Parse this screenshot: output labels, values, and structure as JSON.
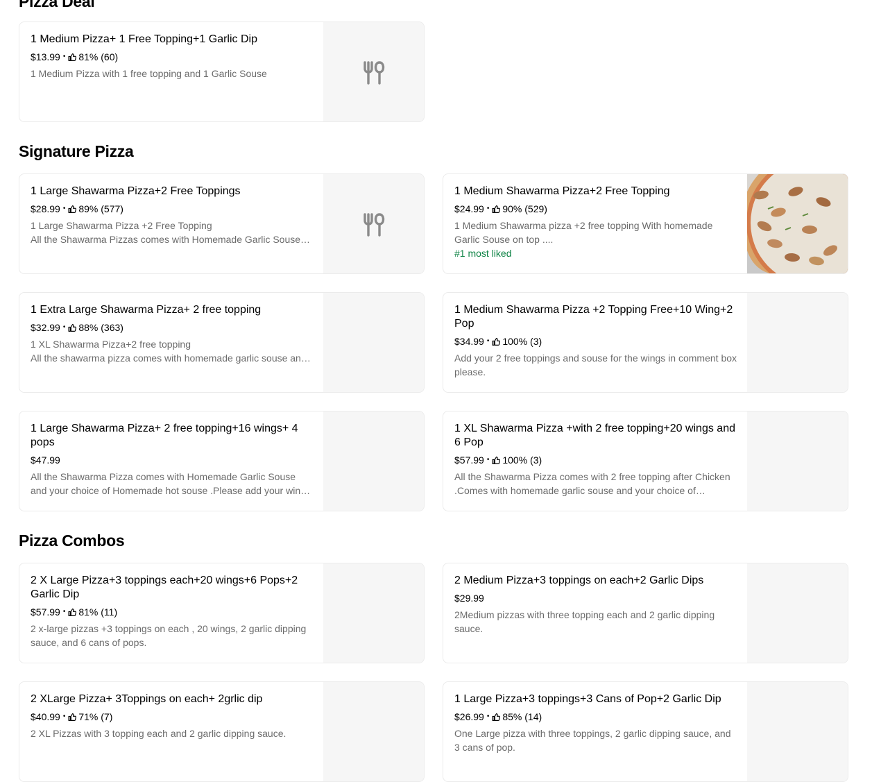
{
  "sections": [
    {
      "title": "Pizza Deal",
      "items": [
        {
          "name": "1 Medium Pizza+ 1 Free Topping+1 Garlic Dip",
          "price": "$13.99",
          "rating": "81% (60)",
          "desc": "1 Medium Pizza with 1 free topping and 1 Garlic Souse",
          "image": "utensils-icon"
        }
      ]
    },
    {
      "title": "Signature Pizza",
      "items": [
        {
          "name": "1 Large Shawarma Pizza+2 Free Toppings",
          "price": "$28.99",
          "rating": "89% (577)",
          "desc": "1 Large Shawarma Pizza +2 Free Topping\nAll the Shawarma Pizzas comes with Homemade Garlic Souse and your choice of Homemade hot souse",
          "image": "utensils-icon"
        },
        {
          "name": "1 Medium Shawarma Pizza+2 Free Topping",
          "price": "$24.99",
          "rating": "90% (529)",
          "desc": "1 Medium Shawarma pizza +2 free topping With homemade Garlic Souse on top ....",
          "tag": "#1 most liked",
          "image": "photo"
        },
        {
          "name": "1 Extra Large Shawarma Pizza+ 2 free topping",
          "price": "$32.99",
          "rating": "88% (363)",
          "desc": "1 XL Shawarma Pizza+2 free topping\nAll the shawarma pizza comes with homemade garlic souse and your choice of homemade hot souse",
          "image": "blank"
        },
        {
          "name": "1 Medium Shawarma Pizza +2 Topping Free+10 Wing+2 Pop",
          "price": "$34.99",
          "rating": "100% (3)",
          "desc": "Add your 2 free toppings and souse for the wings in comment box please.",
          "image": "blank"
        },
        {
          "name": "1 Large Shawarma Pizza+ 2 free topping+16 wings+ 4 pops",
          "price": "$47.99",
          "rating": "",
          "desc": "All the Shawarma Pizza comes with Homemade Garlic Souse and your choice of Homemade hot souse .Please add your wings souse in comment box",
          "image": "blank"
        },
        {
          "name": "1 XL Shawarma Pizza +with 2 free topping+20 wings and 6 Pop",
          "price": "$57.99",
          "rating": "100% (3)",
          "desc": "All the Shawarma Pizza comes with 2 free topping after Chicken .Comes with homemade garlic souse and your choice of homemade hot souse",
          "image": "blank"
        }
      ]
    },
    {
      "title": "Pizza Combos",
      "items": [
        {
          "name": "2 X Large Pizza+3 toppings each+20 wings+6 Pops+2 Garlic Dip",
          "price": "$57.99",
          "rating": "81% (11)",
          "desc": "2 x-large pizzas +3 toppings on each , 20 wings, 2 garlic dipping sauce, and 6 cans of pops.",
          "image": "blank"
        },
        {
          "name": "2 Medium Pizza+3 toppings on each+2 Garlic Dips",
          "price": "$29.99",
          "rating": "",
          "desc": "2Medium pizzas with three topping each and 2 garlic dipping sauce.",
          "image": "blank"
        },
        {
          "name": "2  XLarge Pizza+ 3Toppings on each+ 2grlic dip",
          "price": "$40.99",
          "rating": "71% (7)",
          "desc": "2 XL Pizzas with 3 topping each and 2 garlic dipping sauce.",
          "image": "blank"
        },
        {
          "name": "1 Large Pizza+3 toppings+3 Cans of Pop+2 Garlic Dip",
          "price": "$26.99",
          "rating": "85% (14)",
          "desc": "One Large pizza with three toppings, 2 garlic dipping sauce, and 3 cans of pop.",
          "image": "blank"
        }
      ]
    }
  ]
}
